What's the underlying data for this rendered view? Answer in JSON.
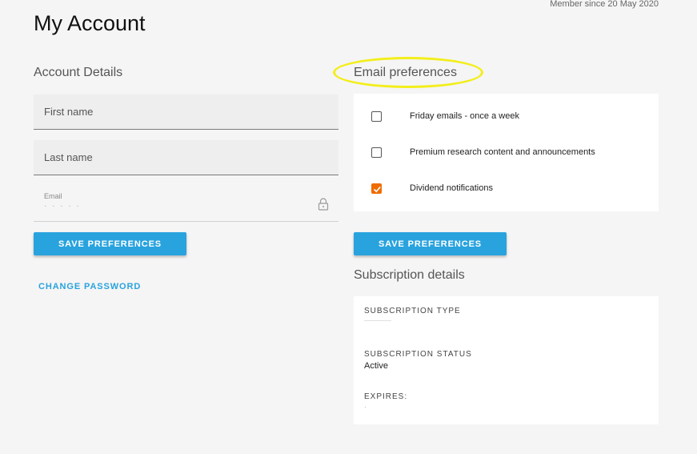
{
  "header": {
    "member_since": "Member since 20 May 2020",
    "title": "My Account"
  },
  "account_details": {
    "title": "Account Details",
    "first_name_placeholder": "First name",
    "last_name_placeholder": "Last name",
    "email_label": "Email",
    "save_label": "SAVE PREFERENCES",
    "change_password_label": "CHANGE PASSWORD"
  },
  "email_preferences": {
    "title": "Email preferences",
    "options": [
      {
        "label": "Friday emails - once a week",
        "checked": false
      },
      {
        "label": "Premium research content and announcements",
        "checked": false
      },
      {
        "label": "Dividend notifications",
        "checked": true
      }
    ],
    "save_label": "SAVE PREFERENCES"
  },
  "subscription": {
    "title": "Subscription details",
    "type_label": "SUBSCRIPTION TYPE",
    "status_label": "SUBSCRIPTION STATUS",
    "status_value": "Active",
    "expires_label": "EXPIRES:"
  },
  "colors": {
    "accent": "#29a3de",
    "checkbox_checked": "#ef6c00",
    "annotation": "#f2ee1a"
  }
}
